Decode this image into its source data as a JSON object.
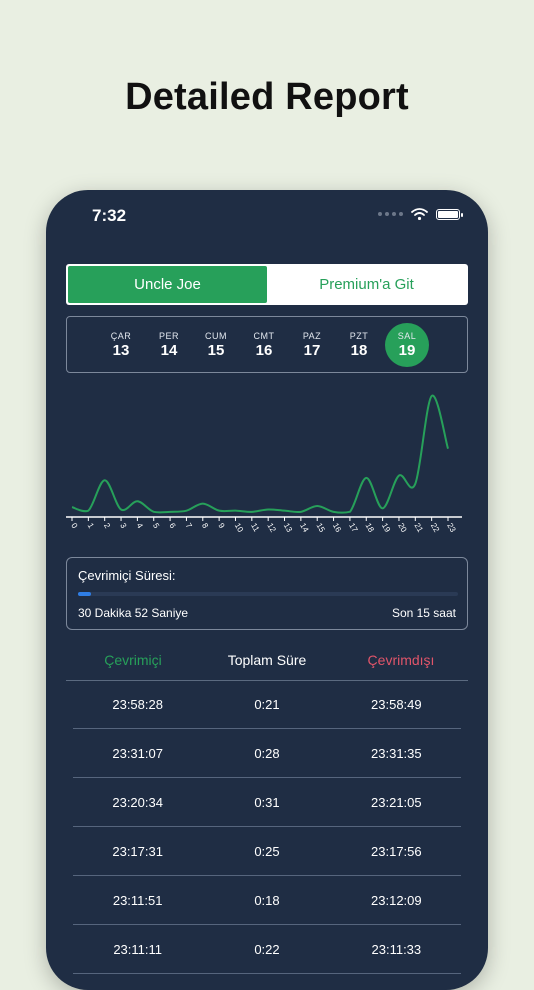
{
  "headline": "Detailed Report",
  "status": {
    "time": "7:32"
  },
  "segment": {
    "active": "Uncle Joe",
    "inactive": "Premium'a Git"
  },
  "days": [
    {
      "name": "ÇAR",
      "date": "13",
      "selected": false
    },
    {
      "name": "PER",
      "date": "14",
      "selected": false
    },
    {
      "name": "CUM",
      "date": "15",
      "selected": false
    },
    {
      "name": "CMT",
      "date": "16",
      "selected": false
    },
    {
      "name": "PAZ",
      "date": "17",
      "selected": false
    },
    {
      "name": "PZT",
      "date": "18",
      "selected": false
    },
    {
      "name": "SAL",
      "date": "19",
      "selected": true
    }
  ],
  "colors": {
    "accent": "#27a05a",
    "offline": "#e0556a",
    "progress": "#2f7ee6",
    "panel": "#1f2d44"
  },
  "chart_data": {
    "type": "line",
    "x": [
      "0",
      "1",
      "2",
      "3",
      "4",
      "5",
      "6",
      "7",
      "8",
      "9",
      "10",
      "11",
      "12",
      "13",
      "14",
      "15",
      "16",
      "17",
      "18",
      "19",
      "20",
      "21",
      "22",
      "23"
    ],
    "values": [
      0.05,
      0.02,
      0.28,
      0.03,
      0.1,
      0.01,
      0.01,
      0.02,
      0.08,
      0.02,
      0.02,
      0.01,
      0.03,
      0.02,
      0.01,
      0.06,
      0.01,
      0.01,
      0.3,
      0.04,
      0.32,
      0.25,
      1.0,
      0.55
    ],
    "xlabel": "",
    "ylabel": "",
    "grid": false
  },
  "online": {
    "title": "Çevrimiçi Süresi:",
    "duration": "30 Dakika 52 Saniye",
    "range": "Son 15 saat",
    "progress": 0.034
  },
  "table": {
    "headers": {
      "online": "Çevrimiçi",
      "total": "Toplam Süre",
      "offline": "Çevrimdışı"
    },
    "rows": [
      {
        "online": "23:58:28",
        "total": "0:21",
        "offline": "23:58:49"
      },
      {
        "online": "23:31:07",
        "total": "0:28",
        "offline": "23:31:35"
      },
      {
        "online": "23:20:34",
        "total": "0:31",
        "offline": "23:21:05"
      },
      {
        "online": "23:17:31",
        "total": "0:25",
        "offline": "23:17:56"
      },
      {
        "online": "23:11:51",
        "total": "0:18",
        "offline": "23:12:09"
      },
      {
        "online": "23:11:11",
        "total": "0:22",
        "offline": "23:11:33"
      }
    ]
  }
}
